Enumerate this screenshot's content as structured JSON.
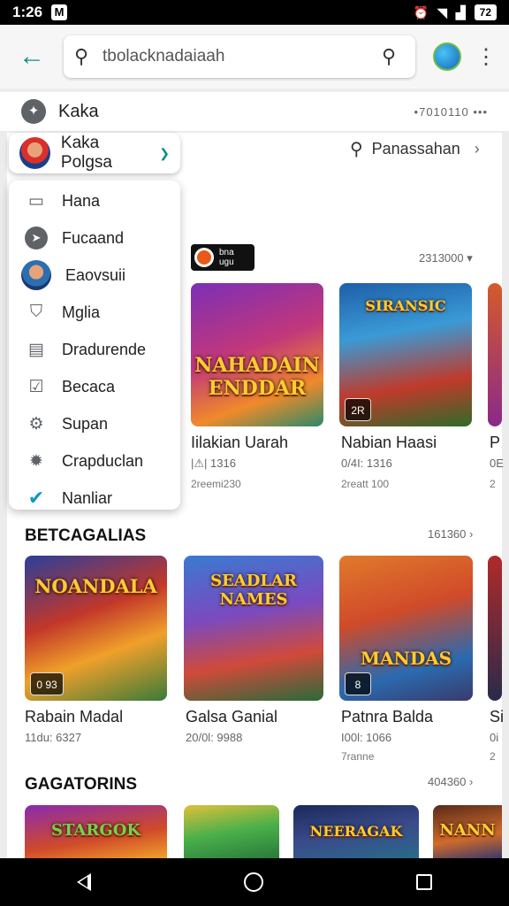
{
  "status": {
    "time": "1:26",
    "notif_icon": "M",
    "battery": "72"
  },
  "appbar": {
    "back_icon": "arrow-left-icon",
    "search_value": "tbolacknadaiaah",
    "search_icon": "search-icon"
  },
  "subheader": {
    "label": "Kaka",
    "right_text": "•7010110 •••"
  },
  "profile": {
    "name": "Kaka Polgsa"
  },
  "top_search": {
    "label": "Panassahan"
  },
  "menu": [
    {
      "label": "Hana",
      "icon": "folder-icon"
    },
    {
      "label": "Fucaand",
      "icon": "navigation-icon"
    },
    {
      "label": "Eaovsuii",
      "icon": "avatar-icon"
    },
    {
      "label": "Mglia",
      "icon": "shield-icon"
    },
    {
      "label": "Dradurende",
      "icon": "document-icon"
    },
    {
      "label": "Becaca",
      "icon": "checkbox-icon"
    },
    {
      "label": "Supan",
      "icon": "gear-icon"
    },
    {
      "label": "Crapduclan",
      "icon": "settings-icon"
    },
    {
      "label": "Nanliar",
      "icon": "check-circle-icon"
    }
  ],
  "section1": {
    "badge_text": "bna ugu",
    "count": "2313000 ▾",
    "cards": [
      {
        "art": "NAHADAIN ENDDAR",
        "corner": "",
        "title": "Iilakian Uarah",
        "meta": "|⚠| 1316",
        "meta2": "2reemi230"
      },
      {
        "art": "SIRANSIC",
        "corner": "2R",
        "title": "Nabian Haasi",
        "meta": "0/4I: 1316",
        "meta2": "2reatt 100"
      },
      {
        "art": "",
        "corner": "",
        "title": "P",
        "meta": "0E",
        "meta2": "2"
      }
    ]
  },
  "section2": {
    "title": "BETCAGALIAS",
    "count": "161360 ›",
    "cards": [
      {
        "art": "NOANDALA",
        "corner": "0 93",
        "title": "Rabain Madal",
        "meta": "11du: 6327",
        "meta2": ""
      },
      {
        "art": "SEADLAR NAMES",
        "corner": "",
        "title": "Galsa Ganial",
        "meta": "20/0l: 9988",
        "meta2": ""
      },
      {
        "art": "MANDAS",
        "corner": "8",
        "title": "Patnra Balda",
        "meta": "I00l: 1066",
        "meta2": "7ranne"
      },
      {
        "art": "",
        "corner": "",
        "title": "Si",
        "meta": "0i",
        "meta2": "2"
      }
    ]
  },
  "section3": {
    "title": "GAGATORINS",
    "count": "404360 ›",
    "cards": [
      {
        "art": "STARGOK"
      },
      {
        "art": ""
      },
      {
        "art": "NEERAGAK"
      },
      {
        "art": "NANN"
      }
    ]
  }
}
